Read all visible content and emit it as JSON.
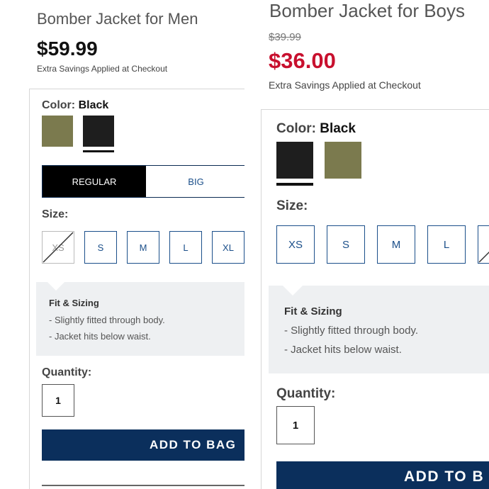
{
  "left": {
    "title": "Bomber Jacket for Men",
    "price": "$59.99",
    "savings": "Extra Savings Applied at Checkout",
    "color_label": "Color:",
    "color_value": "Black",
    "swatches": [
      {
        "name": "olive",
        "color": "#7b7a4e",
        "selected": false
      },
      {
        "name": "black",
        "color": "#1e1e1e",
        "selected": true
      }
    ],
    "fit_tabs": [
      {
        "label": "REGULAR",
        "active": true
      },
      {
        "label": "BIG",
        "active": false
      }
    ],
    "size_label": "Size:",
    "sizes": [
      {
        "label": "XS",
        "available": false
      },
      {
        "label": "S",
        "available": true
      },
      {
        "label": "M",
        "available": true
      },
      {
        "label": "L",
        "available": true
      },
      {
        "label": "XL",
        "available": true
      }
    ],
    "fit_title": "Fit & Sizing",
    "fit_points": [
      "- Slightly fitted through body.",
      "- Jacket hits below waist."
    ],
    "quantity_label": "Quantity:",
    "quantity_value": "1",
    "add_button": "ADD TO BAG"
  },
  "right": {
    "title": "Bomber Jacket for Boys",
    "original_price": "$39.99",
    "sale_price": "$36.00",
    "savings": "Extra Savings Applied at Checkout",
    "color_label": "Color:",
    "color_value": "Black",
    "swatches": [
      {
        "name": "black",
        "color": "#1e1e1e",
        "selected": true
      },
      {
        "name": "olive",
        "color": "#7b7a4e",
        "selected": false
      }
    ],
    "size_label": "Size:",
    "sizes": [
      {
        "label": "XS",
        "available": true
      },
      {
        "label": "S",
        "available": true
      },
      {
        "label": "M",
        "available": true
      },
      {
        "label": "L",
        "available": true
      },
      {
        "label": "",
        "available": false
      }
    ],
    "fit_title": "Fit & Sizing",
    "fit_points": [
      "- Slightly fitted through body.",
      "- Jacket hits below waist."
    ],
    "quantity_label": "Quantity:",
    "quantity_value": "1",
    "add_button": "ADD TO B"
  },
  "colors": {
    "accent_navy": "#0b2f5c",
    "sale_red": "#c8102e",
    "size_border": "#1b4f8a"
  }
}
